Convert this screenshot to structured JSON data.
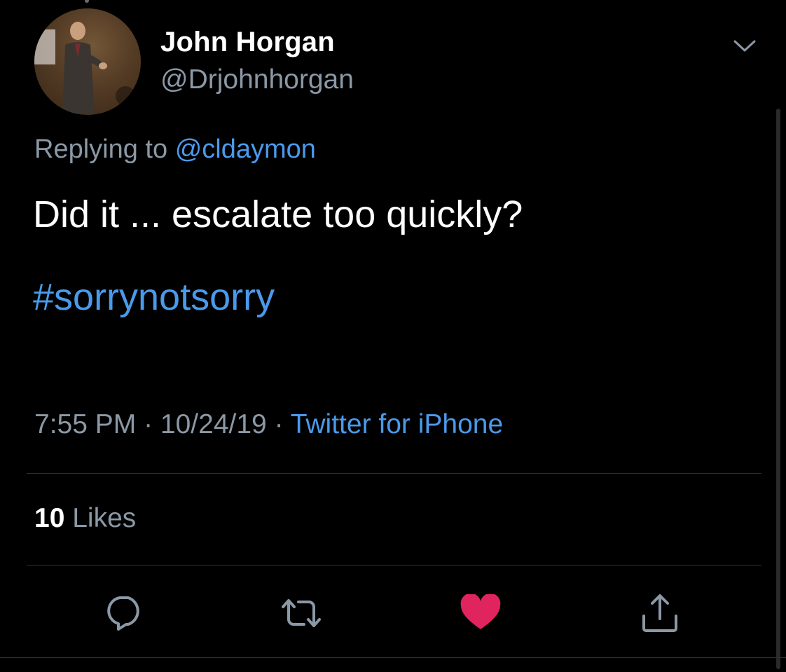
{
  "author": {
    "name": "John Horgan",
    "handle": "@Drjohnhorgan"
  },
  "reply": {
    "prefix": "Replying to",
    "mention": "@cldaymon"
  },
  "tweet": {
    "text": "Did it ... escalate too quickly?",
    "hashtag": "#sorrynotsorry"
  },
  "meta": {
    "time": "7:55 PM",
    "separator": " · ",
    "date": "10/24/19",
    "source": "Twitter for iPhone"
  },
  "stats": {
    "likes_count": "10",
    "likes_label": "Likes"
  },
  "actions": [
    {
      "icon": "reply-icon"
    },
    {
      "icon": "retweet-icon"
    },
    {
      "icon": "like-icon",
      "active": true
    },
    {
      "icon": "share-icon"
    }
  ],
  "colors": {
    "background": "#000000",
    "link": "#4a9aeb",
    "secondary_text": "#8b98a5",
    "like_active": "#e0245e",
    "divider": "#2f3336"
  }
}
